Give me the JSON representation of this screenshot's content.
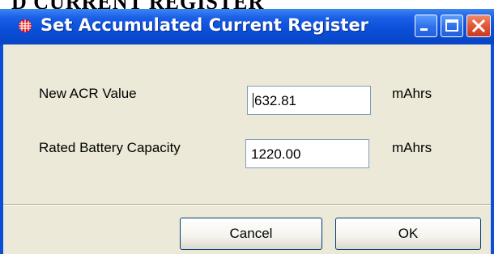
{
  "background": {
    "heading_fragment": "D CURRENT REGISTER"
  },
  "window": {
    "title": "Set Accumulated Current Register",
    "app_icon": "red-grid-icon",
    "controls": {
      "minimize": "minimize-icon",
      "maximize": "maximize-icon",
      "close": "close-icon"
    }
  },
  "form": {
    "acr": {
      "label": "New ACR Value",
      "value": "632.81",
      "unit": "mAhrs"
    },
    "capacity": {
      "label": "Rated Battery Capacity",
      "value": "1220.00",
      "unit": "mAhrs"
    }
  },
  "buttons": {
    "cancel": "Cancel",
    "ok": "OK"
  },
  "colors": {
    "titlebar": "#0a4ed8",
    "client": "#ece9d8",
    "close_button": "#e2573a",
    "app_icon": "#e01010"
  }
}
